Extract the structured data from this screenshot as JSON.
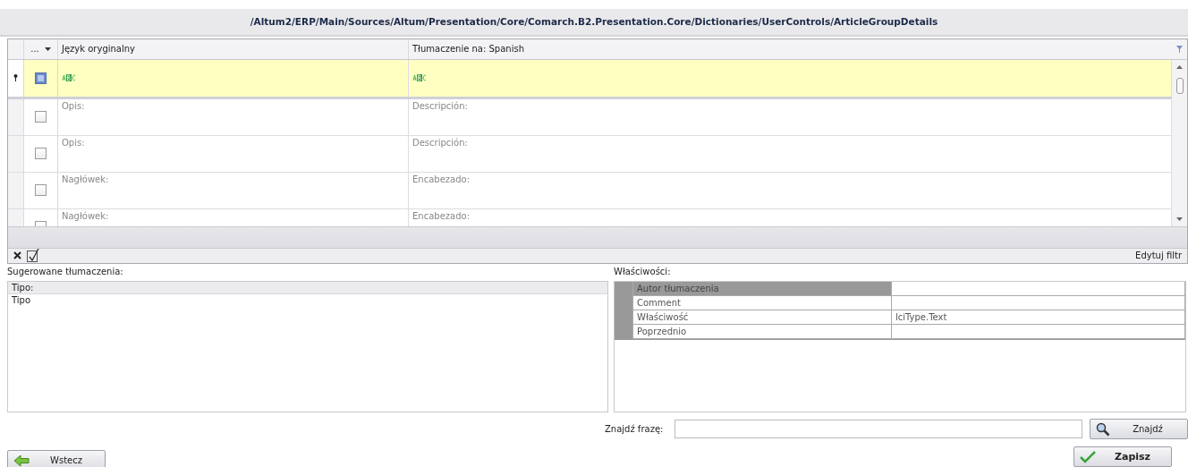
{
  "title": "/Altum2/ERP/Main/Sources/Altum/Presentation/Core/Comarch.B2.Presentation.Core/Dictionaries/UserControls/ArticleGroupDetails",
  "grid": {
    "menu_label": "...",
    "columns": [
      "Język oryginalny",
      "Tłumaczenie na: Spanish"
    ],
    "rows": [
      {
        "kind": "new",
        "selected": true,
        "checked": false
      },
      {
        "kind": "text",
        "selected": false,
        "checked": false,
        "original": "Opis:",
        "translation": "Descripción:"
      },
      {
        "kind": "text",
        "selected": false,
        "checked": false,
        "original": "Opis:",
        "translation": "Descripción:"
      },
      {
        "kind": "text",
        "selected": false,
        "checked": false,
        "original": "Nagłówek:",
        "translation": "Encabezado:"
      },
      {
        "kind": "text",
        "selected": false,
        "checked": false,
        "original": "Nagłówek:",
        "translation": "Encabezado:"
      }
    ],
    "filter_link": "Edytuj filtr"
  },
  "suggestions": {
    "label": "Sugerowane tłumaczenia:",
    "header": "Tipo:",
    "items": [
      "Tipo"
    ]
  },
  "properties": {
    "label": "Właściwości:",
    "rows": [
      {
        "name": "Autor tłumaczenia",
        "value": "",
        "selected": true
      },
      {
        "name": "Comment",
        "value": "",
        "selected": false
      },
      {
        "name": "Właściwość",
        "value": "lciType.Text",
        "selected": false
      },
      {
        "name": "Poprzednio",
        "value": "",
        "selected": false
      }
    ]
  },
  "find": {
    "label": "Znajdź frazę:",
    "button": "Znajdź"
  },
  "back_button": "Wstecz",
  "save_button": "Zapisz"
}
